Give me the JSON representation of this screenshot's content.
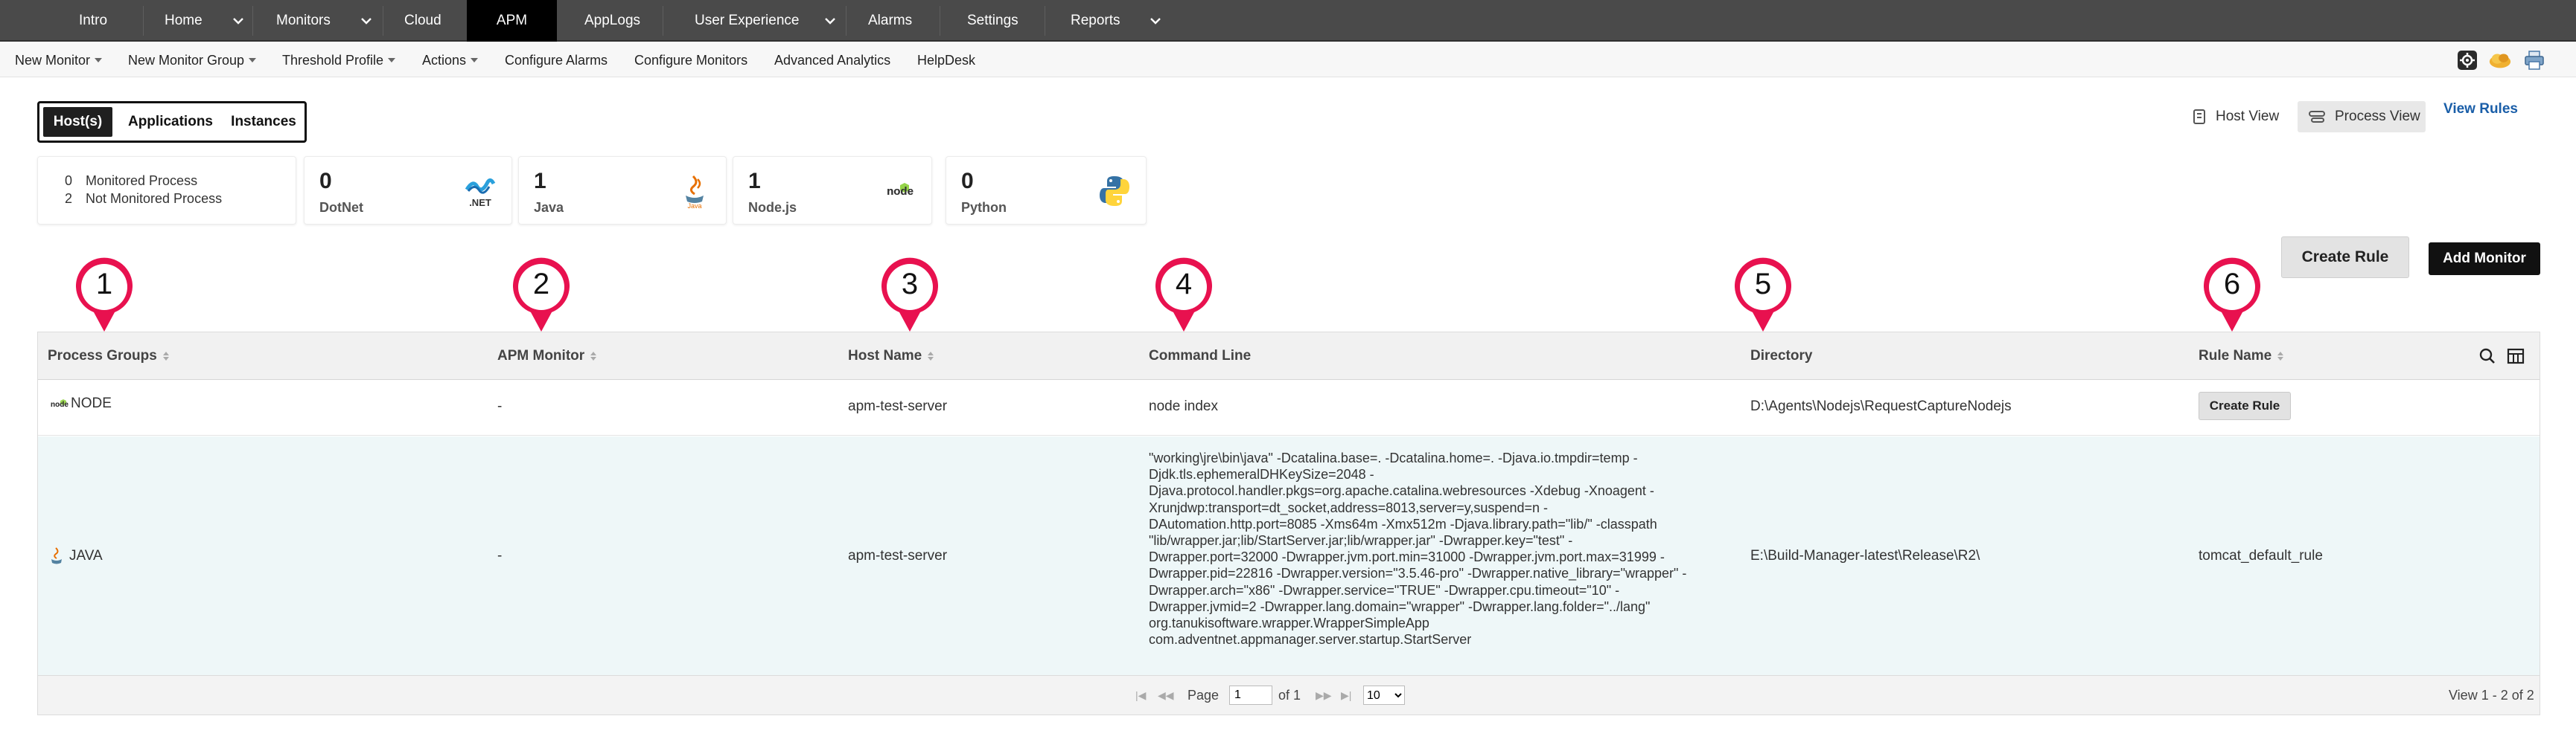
{
  "topnav": {
    "tabs": [
      "Intro",
      "Home",
      "Monitors",
      "Cloud",
      "APM",
      "AppLogs",
      "User Experience",
      "Alarms",
      "Settings",
      "Reports"
    ],
    "active": "APM"
  },
  "subnav": {
    "items": [
      "New Monitor",
      "New Monitor Group",
      "Threshold Profile",
      "Actions",
      "Configure Alarms",
      "Configure Monitors",
      "Advanced Analytics",
      "HelpDesk"
    ],
    "icons": [
      "settings-icon",
      "cloud-icon",
      "print-icon"
    ]
  },
  "view_tabs": [
    "Host(s)",
    "Applications",
    "Instances"
  ],
  "view_switch": {
    "host_view": "Host View",
    "process_view": "Process View",
    "view_rules": "View Rules"
  },
  "summary": {
    "monitored_count": "0",
    "monitored_label": "Monitored Process",
    "not_monitored_count": "2",
    "not_monitored_label": "Not Monitored Process",
    "cards": [
      {
        "count": "0",
        "label": "DotNet",
        "icon": "dotnet-logo"
      },
      {
        "count": "1",
        "label": "Java",
        "icon": "java-logo"
      },
      {
        "count": "1",
        "label": "Node.js",
        "icon": "nodejs-logo"
      },
      {
        "count": "0",
        "label": "Python",
        "icon": "python-logo"
      }
    ]
  },
  "actions": {
    "create_rule": "Create Rule",
    "add_monitor": "Add Monitor"
  },
  "markers": [
    "1",
    "2",
    "3",
    "4",
    "5",
    "6"
  ],
  "table": {
    "columns": [
      "Process Groups",
      "APM Monitor",
      "Host Name",
      "Command Line",
      "Directory",
      "Rule Name"
    ],
    "rows": [
      {
        "group": "NODE",
        "icon": "nodejs-logo",
        "apm_monitor": "-",
        "host": "apm-test-server",
        "command": "node index",
        "directory": "D:\\Agents\\Nodejs\\RequestCaptureNodejs",
        "rule_button": "Create Rule"
      },
      {
        "group": "JAVA",
        "icon": "java-logo",
        "apm_monitor": "-",
        "host": "apm-test-server",
        "command_lines": [
          "\"working\\jre\\bin\\java\" -Dcatalina.base=. -Dcatalina.home=. -Djava.io.tmpdir=temp -",
          "Djdk.tls.ephemeralDHKeySize=2048 -",
          "Djava.protocol.handler.pkgs=org.apache.catalina.webresources -Xdebug -Xnoagent -",
          "Xrunjdwp:transport=dt_socket,address=8013,server=y,suspend=n -",
          "DAutomation.http.port=8085 -Xms64m -Xmx512m -Djava.library.path=\"lib/\" -classpath",
          "\"lib/wrapper.jar;lib/StartServer.jar;lib/wrapper.jar\" -Dwrapper.key=\"test\" -",
          "Dwrapper.port=32000 -Dwrapper.jvm.port.min=31000 -Dwrapper.jvm.port.max=31999 -",
          "Dwrapper.pid=22816 -Dwrapper.version=\"3.5.46-pro\" -Dwrapper.native_library=\"wrapper\" -",
          "Dwrapper.arch=\"x86\" -Dwrapper.service=\"TRUE\" -Dwrapper.cpu.timeout=\"10\" -",
          "Dwrapper.jvmid=2 -Dwrapper.lang.domain=\"wrapper\" -Dwrapper.lang.folder=\"../lang\"",
          "org.tanukisoftware.wrapper.WrapperSimpleApp",
          "com.adventnet.appmanager.server.startup.StartServer"
        ],
        "directory": "E:\\Build-Manager-latest\\Release\\R2\\",
        "rule_name": "tomcat_default_rule"
      }
    ],
    "toolbar_icons": [
      "search-icon",
      "columns-icon"
    ]
  },
  "pager": {
    "page_label": "Page",
    "page_value": "1",
    "of_label": "of 1",
    "page_size": "10",
    "view_range": "View 1 - 2 of 2"
  },
  "colors": {
    "topnav_bg": "#4a4a4a",
    "active_tab": "#000000",
    "marker": "#e8114f",
    "link": "#1a5ea8",
    "row_highlight": "#eef7f8"
  }
}
